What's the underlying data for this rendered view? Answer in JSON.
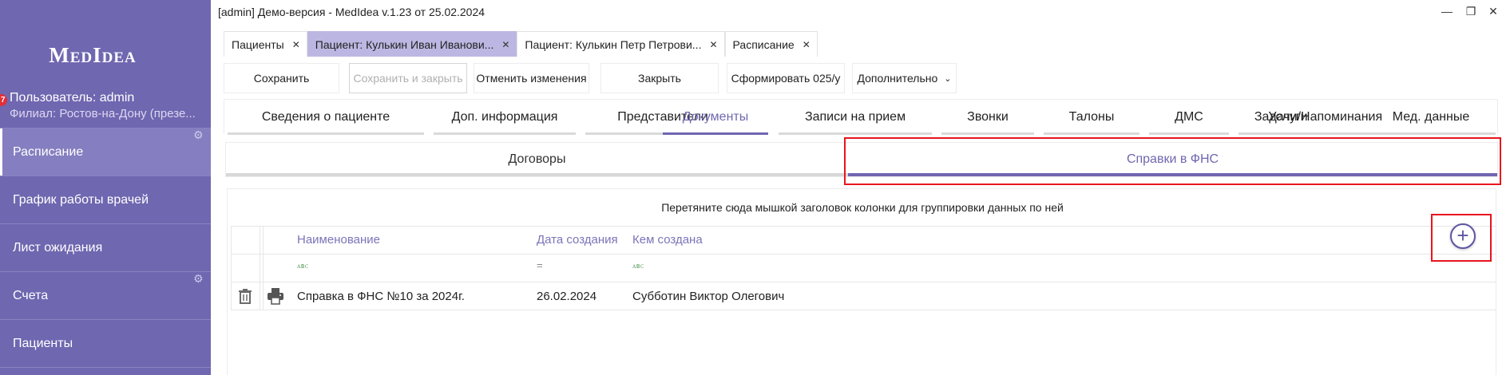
{
  "window": {
    "title": "[admin] Демо-версия  - MedIdea v.1.23 от 25.02.2024",
    "minimize": "—",
    "maximize": "❐",
    "close": "✕"
  },
  "sidebar": {
    "logo": "MedIdea",
    "badge": "7",
    "user": "Пользователь: admin",
    "branch": "Филиал: Ростов-на-Дону (презе...",
    "items": [
      {
        "label": "Расписание",
        "active": true
      },
      {
        "label": "График работы врачей"
      },
      {
        "label": "Лист ожидания"
      },
      {
        "label": "Счета"
      },
      {
        "label": "Пациенты"
      }
    ]
  },
  "doc_tabs": [
    {
      "label": "Пациенты",
      "close": "✕"
    },
    {
      "label": "Пациент: Кулькин Иван Иванови...",
      "close": "✕",
      "active": true
    },
    {
      "label": "Пациент: Кулькин Петр Петрови...",
      "close": "✕"
    },
    {
      "label": "Расписание",
      "close": "✕"
    }
  ],
  "toolbar": {
    "save": "Сохранить",
    "save_close": "Сохранить и закрыть",
    "cancel": "Отменить изменения",
    "close": "Закрыть",
    "form": "Сформировать 025/у",
    "more": "Дополнительно",
    "more_chevron": "⌄"
  },
  "main_tabs": [
    "Сведения о пациенте",
    "Доп. информация",
    "Представители",
    "Документы",
    "Записи на прием",
    "Звонки",
    "Талоны",
    "ДМС",
    "Услуги",
    "Задачи/Напоминания",
    "Мед. данные"
  ],
  "main_tabs_active": "Документы",
  "sub_tabs": [
    "Договоры",
    "Справки в ФНС"
  ],
  "sub_tabs_active": "Справки в ФНС",
  "grid": {
    "group_hint": "Перетяните сюда мышкой заголовок колонки для группировки данных по ней",
    "columns": [
      "Наименование",
      "Дата создания",
      "Кем создана"
    ],
    "filter_icons": [
      "ᴀʙᴄ",
      "=",
      "ᴀʙᴄ"
    ],
    "rows": [
      {
        "name": "Справка в ФНС №10 за 2024г.",
        "date": "26.02.2024",
        "author": "Субботин Виктор Олегович"
      }
    ],
    "add_symbol": "+"
  },
  "colors": {
    "accent": "#6f67b0",
    "highlight": "#e8141e",
    "active_doc_tab": "#bcb7e2"
  },
  "icons": {
    "settings": "gear-icon",
    "delete": "trash-icon",
    "print": "printer-icon",
    "add": "plus-circle-icon"
  }
}
